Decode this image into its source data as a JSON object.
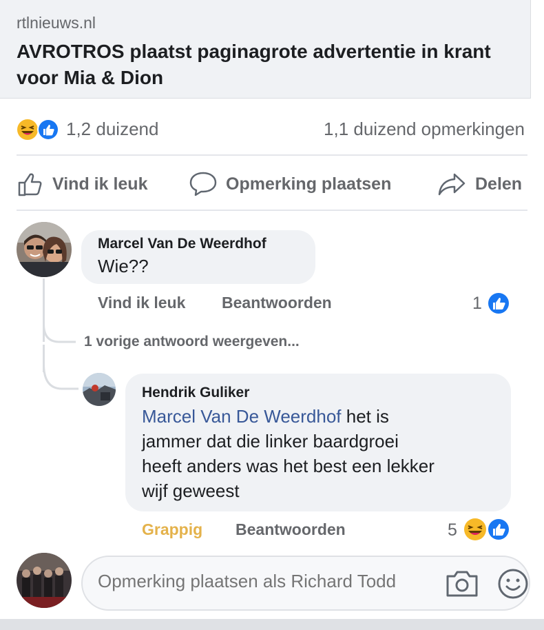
{
  "link": {
    "domain": "rtlnieuws.nl",
    "title": "AVROTROS plaatst paginagrote advertentie in krant voor Mia & Dion"
  },
  "stats": {
    "reactions_count": "1,2 duizend",
    "comments_count": "1,1 duizend opmerkingen",
    "reaction_icons": [
      "haha-icon",
      "like-icon"
    ]
  },
  "actions": {
    "like": "Vind ik leuk",
    "comment": "Opmerking plaatsen",
    "share": "Delen"
  },
  "comments": [
    {
      "author": "Marcel Van De Weerdhof",
      "text": "Wie??",
      "like_label": "Vind ik leuk",
      "reply_label": "Beantwoorden",
      "reaction_count": "1",
      "reaction_icons": [
        "like-icon"
      ]
    }
  ],
  "previous_replies": "1 vorige antwoord weergeven...",
  "reply": {
    "author": "Hendrik Guliker",
    "mention": "Marcel Van De Weerdhof",
    "text_line1": " het is",
    "text_line2": "jammer dat die linker baardgroei",
    "text_line3": "heeft anders was het best een lekker",
    "text_line4": "wijf geweest",
    "reaction_label": "Grappig",
    "reply_label": "Beantwoorden",
    "reaction_count": "5",
    "reaction_icons": [
      "haha-icon",
      "like-icon"
    ]
  },
  "composer": {
    "placeholder": "Opmerking plaatsen als Richard Todd",
    "icons": [
      "camera-icon",
      "emoji-icon"
    ]
  },
  "colors": {
    "like_blue": "#1877f2",
    "haha_yellow": "#f7b928",
    "mention_blue": "#385898",
    "funny_label": "#e4b24b",
    "bubble_bg": "#f0f2f5",
    "muted_text": "#65676b"
  }
}
